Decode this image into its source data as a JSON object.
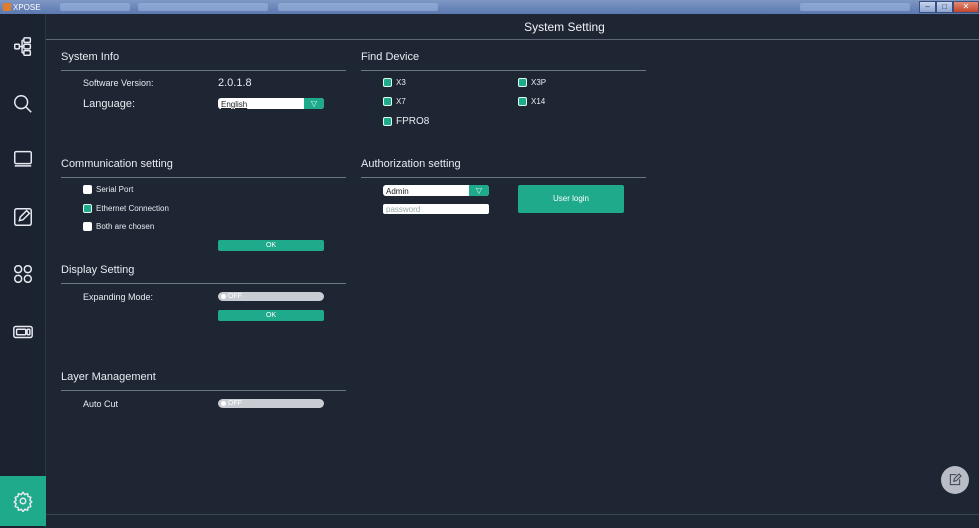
{
  "window": {
    "app_title": "XPOSE",
    "controls": [
      "–",
      "□",
      "✕"
    ]
  },
  "sidebar": {
    "items": [
      {
        "icon": "layout-icon"
      },
      {
        "icon": "search-icon"
      },
      {
        "icon": "monitor-icon"
      },
      {
        "icon": "edit-icon"
      },
      {
        "icon": "grid-icon"
      },
      {
        "icon": "device-icon"
      },
      {
        "icon": "settings-icon",
        "active": true
      }
    ]
  },
  "header": {
    "title": "System Setting"
  },
  "system_info": {
    "title": "System Info",
    "software_version_label": "Software Version:",
    "software_version_value": "2.0.1.8",
    "language_label": "Language:",
    "language_value": "English",
    "dropdown_arrow": "▽"
  },
  "communication": {
    "title": "Communication setting",
    "options": [
      {
        "label": "Serial Port",
        "checked": false
      },
      {
        "label": "Ethernet Connection",
        "checked": true
      },
      {
        "label": "Both are chosen",
        "checked": false
      }
    ],
    "ok_label": "OK"
  },
  "display": {
    "title": "Display Setting",
    "expanding_mode_label": "Expanding Mode:",
    "expanding_mode_state": "OFF",
    "ok_label": "OK"
  },
  "layer": {
    "title": "Layer Management",
    "auto_cut_label": "Auto Cut",
    "auto_cut_state": "OFF"
  },
  "find_device": {
    "title": "Find Device",
    "devices": [
      {
        "label": "X3",
        "checked": true
      },
      {
        "label": "X3P",
        "checked": true
      },
      {
        "label": "X7",
        "checked": true
      },
      {
        "label": "X14",
        "checked": true
      },
      {
        "label": "FPRO8",
        "checked": true
      }
    ]
  },
  "authorization": {
    "title": "Authorization setting",
    "user_value": "Admin",
    "dropdown_arrow": "▽",
    "password_placeholder": "password",
    "login_label": "User login"
  },
  "colors": {
    "accent": "#1fab8b",
    "background": "#1e2533"
  }
}
